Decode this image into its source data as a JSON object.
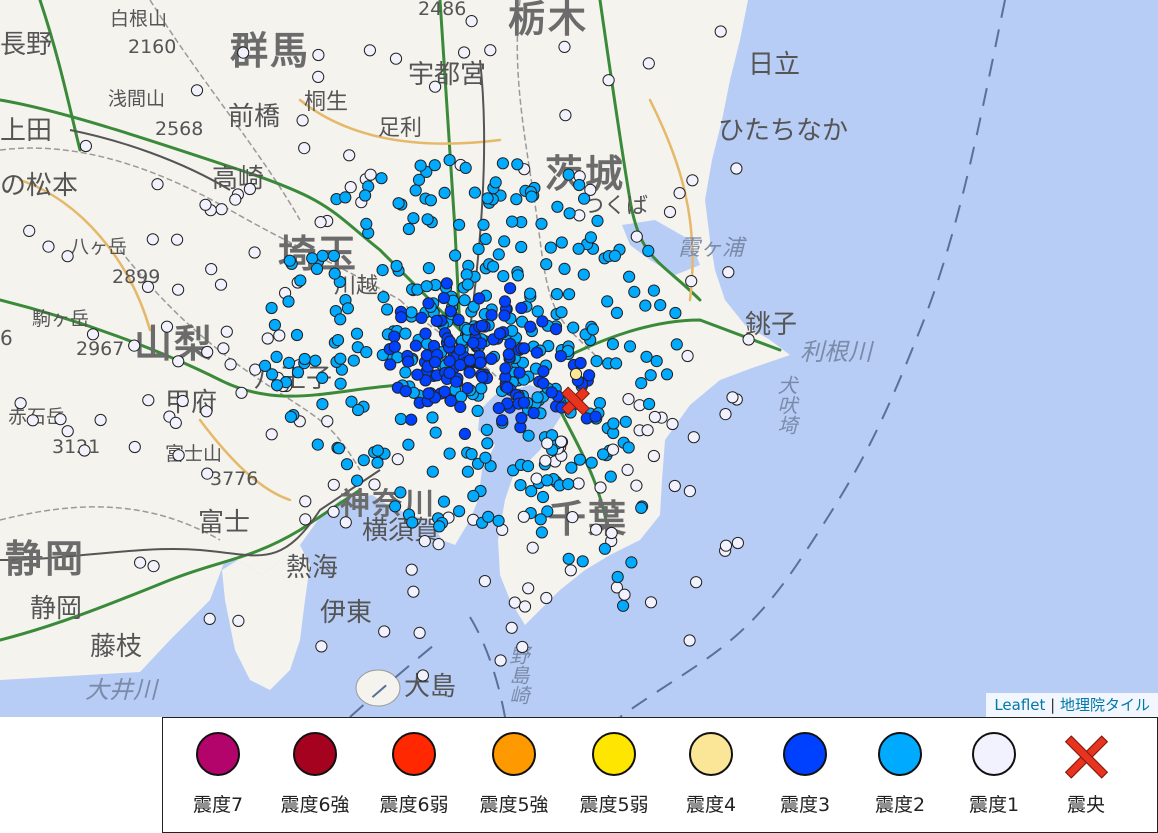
{
  "map": {
    "colors": {
      "sea": "#b8cdf6",
      "land": "#f4f3ee",
      "epicenter": "#e8331f"
    },
    "labels": {
      "gunma": "群馬",
      "saitama": "埼玉",
      "yamanashi": "山梨",
      "ibaraki": "茨城",
      "chiba": "千葉",
      "shizuoka": "静岡",
      "kanagawa": "神奈川",
      "utsunomiya": "宇都宮",
      "maebashi": "前橋",
      "takasaki": "高崎",
      "hitachi": "日立",
      "hitachinaka": "ひたちなか",
      "matsumoto": "の松本",
      "ueda": "上田",
      "choshi": "銚子",
      "tonegawa": "利根川",
      "inubozaki": "犬吠埼",
      "kasumigaura": "霞ヶ浦",
      "hachioji": "八王子",
      "kofu": "甲府",
      "fujiyoshida": "富士山",
      "fuji": "富士",
      "yokosuka": "横須賀",
      "ito": "伊東",
      "oshima": "大島",
      "nojimazaki": "野島崎",
      "shizuoka_city": "静岡",
      "fujieda": "藤枝",
      "ooigawa": "大井川",
      "atami": "熱海",
      "shiraneyama": "白根山",
      "shirane_elev": "2160",
      "asamayama": "浅間山",
      "asama_elev": "2568",
      "yatsugatake": "八ヶ岳",
      "yatsu_elev": "2899",
      "komagatake": "駒ヶ岳",
      "koma_elev": "2967",
      "akaishidake": "赤石岳",
      "akaishi_elev": "3121",
      "fuji_elev": "3776",
      "nikko_elev": "2486",
      "tochigi": "栃木",
      "tsukuba": "つくば",
      "kawagoe": "川越",
      "kiryu": "桐生",
      "ashikaga": "足利",
      "nagano_left": "長野",
      "yamanashi_left": "6"
    },
    "attribution": {
      "leaflet": "Leaflet",
      "sep": " | ",
      "gsi": "地理院タイル"
    }
  },
  "legend": {
    "items": [
      {
        "label": "震度7",
        "color": "#b3046b"
      },
      {
        "label": "震度6強",
        "color": "#a5021f"
      },
      {
        "label": "震度6弱",
        "color": "#ff2800"
      },
      {
        "label": "震度5強",
        "color": "#ff9900"
      },
      {
        "label": "震度5弱",
        "color": "#ffe600"
      },
      {
        "label": "震度4",
        "color": "#fae696"
      },
      {
        "label": "震度3",
        "color": "#0041ff"
      },
      {
        "label": "震度2",
        "color": "#00aaff"
      },
      {
        "label": "震度1",
        "color": "#f2f2ff"
      },
      {
        "label": "震央",
        "color": "#e8331f",
        "icon": "cross-icon"
      }
    ]
  }
}
